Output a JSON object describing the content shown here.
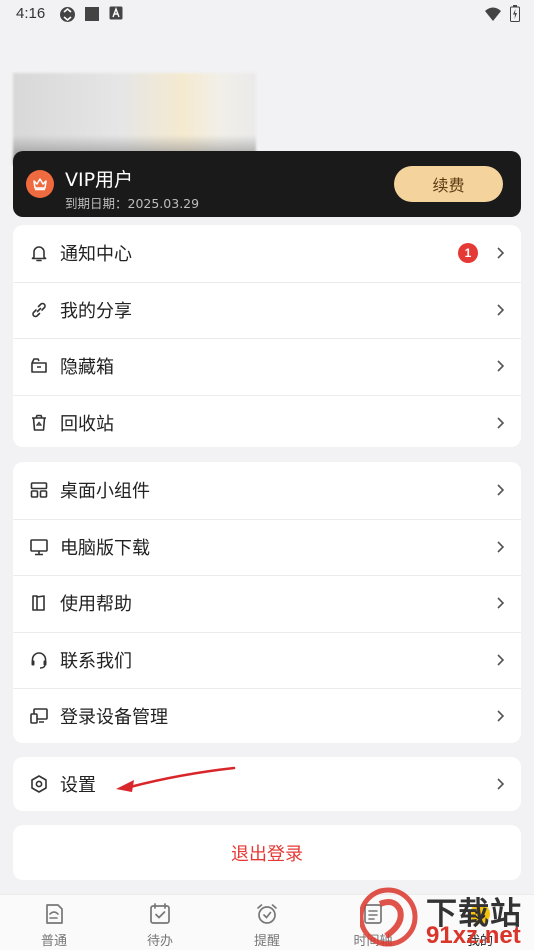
{
  "status_bar": {
    "time": "4:16"
  },
  "profile": {
    "vip_title": "VIP用户",
    "expiry": "到期日期：2025.03.29",
    "renew_label": "续费"
  },
  "menu_group_1": [
    {
      "label": "通知中心",
      "icon": "bell-icon",
      "badge": "1"
    },
    {
      "label": "我的分享",
      "icon": "link-icon"
    },
    {
      "label": "隐藏箱",
      "icon": "hidden-box-icon"
    },
    {
      "label": "回收站",
      "icon": "recycle-bin-icon"
    }
  ],
  "menu_group_2": [
    {
      "label": "桌面小组件",
      "icon": "widget-icon"
    },
    {
      "label": "电脑版下载",
      "icon": "monitor-icon"
    },
    {
      "label": "使用帮助",
      "icon": "book-icon"
    },
    {
      "label": "联系我们",
      "icon": "headset-icon"
    },
    {
      "label": "登录设备管理",
      "icon": "devices-icon"
    }
  ],
  "menu_group_3": [
    {
      "label": "设置",
      "icon": "settings-icon"
    }
  ],
  "logout_label": "退出登录",
  "bottom_nav": [
    {
      "label": "普通",
      "icon": "note-icon"
    },
    {
      "label": "待办",
      "icon": "todo-icon"
    },
    {
      "label": "提醒",
      "icon": "alarm-icon"
    },
    {
      "label": "时间轴",
      "icon": "timeline-icon"
    },
    {
      "label": "我的",
      "icon": "profile-icon",
      "active": true
    }
  ],
  "watermark": {
    "line1": "下载站",
    "line2": "91xz.net"
  },
  "colors": {
    "accent_red": "#e53935",
    "vip_card": "#1a1a1a",
    "renew_button": "#f5d39c",
    "crown_badge": "#ee6a3f",
    "background": "#f2f2f4"
  }
}
